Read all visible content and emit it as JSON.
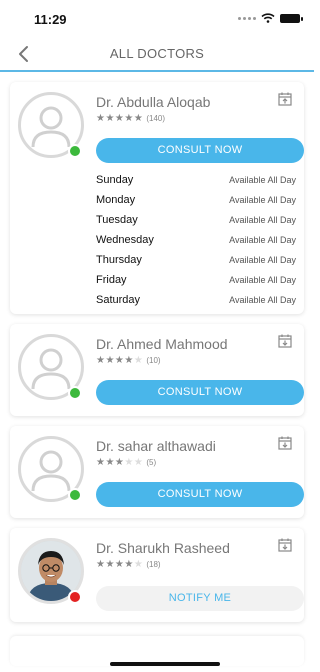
{
  "status_bar": {
    "time": "11:29"
  },
  "nav": {
    "title": "ALL DOCTORS"
  },
  "doctors": [
    {
      "name": "Dr. Abdulla Aloqab",
      "rating_count": "(140)",
      "rating": 5,
      "availability": "online",
      "action_label": "CONSULT NOW",
      "schedule": [
        {
          "day": "Sunday",
          "value": "Available All Day"
        },
        {
          "day": "Monday",
          "value": "Available All Day"
        },
        {
          "day": "Tuesday",
          "value": "Available All Day"
        },
        {
          "day": "Wednesday",
          "value": "Available All Day"
        },
        {
          "day": "Thursday",
          "value": "Available All Day"
        },
        {
          "day": "Friday",
          "value": "Available All Day"
        },
        {
          "day": "Saturday",
          "value": "Available All Day"
        }
      ]
    },
    {
      "name": "Dr. Ahmed Mahmood",
      "rating_count": "(10)",
      "rating": 4.5,
      "availability": "online",
      "action_label": "CONSULT NOW"
    },
    {
      "name": "Dr. sahar althawadi",
      "rating_count": "(5)",
      "rating": 3,
      "availability": "online",
      "action_label": "CONSULT NOW"
    },
    {
      "name": "Dr. Sharukh Rasheed",
      "rating_count": "(18)",
      "rating": 4,
      "availability": "offline",
      "action_label": "NOTIFY ME"
    }
  ],
  "colors": {
    "accent": "#49b6ea",
    "online": "#3cb93c",
    "offline": "#e32222",
    "nav_underline": "#5cb8e6"
  }
}
